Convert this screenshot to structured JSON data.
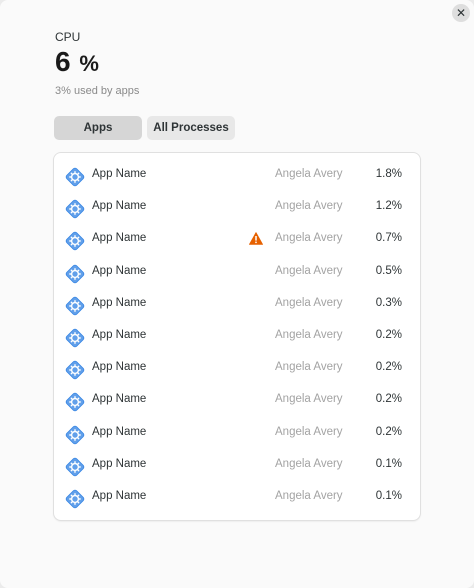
{
  "header": {
    "title": "CPU",
    "value": "6",
    "unit": "%",
    "subtitle": "3% used by apps"
  },
  "tabs": [
    {
      "label": "Apps",
      "active": true
    },
    {
      "label": "All Processes",
      "active": false
    }
  ],
  "colors": {
    "warning": "#e66100",
    "icon_blue": "#62a0ea",
    "icon_blue_dark": "#3584e4"
  },
  "rows": [
    {
      "name": "App Name",
      "user": "Angela Avery",
      "cpu": "1.8%",
      "warning": false
    },
    {
      "name": "App Name",
      "user": "Angela Avery",
      "cpu": "1.2%",
      "warning": false
    },
    {
      "name": "App Name",
      "user": "Angela Avery",
      "cpu": "0.7%",
      "warning": true
    },
    {
      "name": "App Name",
      "user": "Angela Avery",
      "cpu": "0.5%",
      "warning": false
    },
    {
      "name": "App Name",
      "user": "Angela Avery",
      "cpu": "0.3%",
      "warning": false
    },
    {
      "name": "App Name",
      "user": "Angela Avery",
      "cpu": "0.2%",
      "warning": false
    },
    {
      "name": "App Name",
      "user": "Angela Avery",
      "cpu": "0.2%",
      "warning": false
    },
    {
      "name": "App Name",
      "user": "Angela Avery",
      "cpu": "0.2%",
      "warning": false
    },
    {
      "name": "App Name",
      "user": "Angela Avery",
      "cpu": "0.2%",
      "warning": false
    },
    {
      "name": "App Name",
      "user": "Angela Avery",
      "cpu": "0.1%",
      "warning": false
    },
    {
      "name": "App Name",
      "user": "Angela Avery",
      "cpu": "0.1%",
      "warning": false
    }
  ]
}
